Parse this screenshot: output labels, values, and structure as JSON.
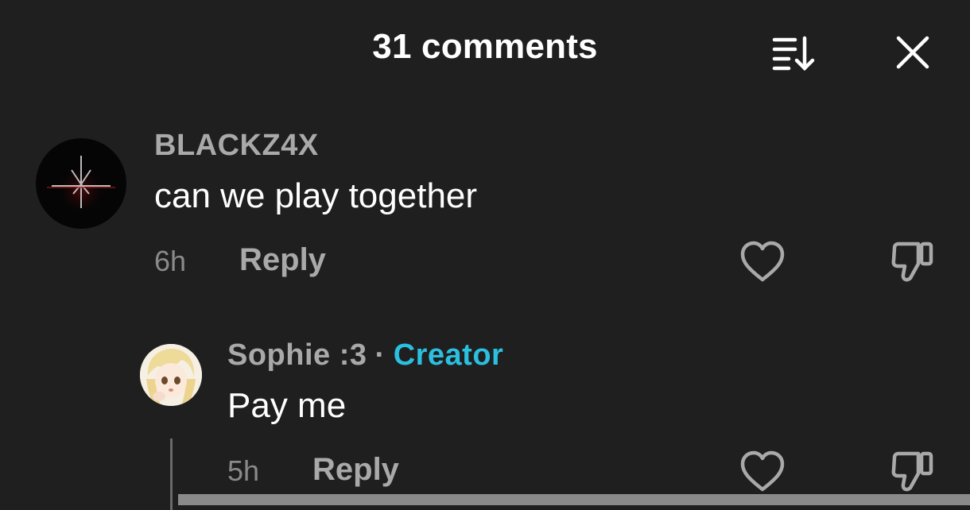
{
  "header": {
    "title": "31 comments",
    "sort_icon": "sort-list-icon",
    "close_icon": "close-icon"
  },
  "comments": [
    {
      "username": "BLACKZ4X",
      "text": "can we play together",
      "time": "6h",
      "reply_label": "Reply",
      "avatar_icon": "dark-emblem-avatar"
    },
    {
      "username": "Sophie :3",
      "separator": "·",
      "badge": "Creator",
      "text": "Pay me",
      "time": "5h",
      "reply_label": "Reply",
      "avatar_icon": "anime-girl-avatar"
    }
  ],
  "colors": {
    "background": "#1f1f1f",
    "username": "#a9a9a9",
    "creator_badge": "#2bbfe0",
    "text": "#ffffff",
    "muted": "#8a8a8a"
  }
}
